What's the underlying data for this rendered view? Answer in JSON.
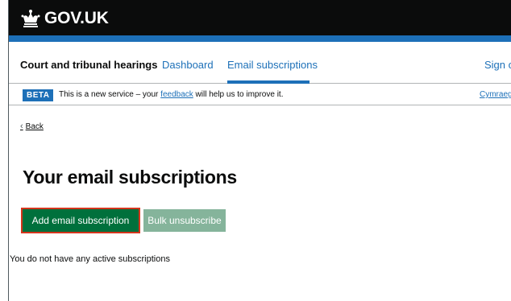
{
  "header": {
    "logo_text": "GOV.UK"
  },
  "service_nav": {
    "service_name": "Court and tribunal hearings",
    "links": [
      {
        "label": "Dashboard"
      },
      {
        "label": "Email subscriptions",
        "active": true
      }
    ],
    "sign_out": "Sign out"
  },
  "phase_banner": {
    "tag": "BETA",
    "text_before": "This is a new service – your ",
    "feedback_link": "feedback",
    "text_after": " will help us to improve it.",
    "language_link": "Cymraeg"
  },
  "back_link": "Back",
  "page": {
    "title": "Your email subscriptions",
    "add_button": "Add email subscription",
    "bulk_button": "Bulk unsubscribe",
    "empty_message": "You do not have any active subscriptions"
  },
  "colors": {
    "header_bg": "#0b0c0c",
    "brand_blue": "#1d70b8",
    "primary_green": "#00703c",
    "disabled_green": "#85b49b",
    "highlight_red": "#d4351c"
  }
}
